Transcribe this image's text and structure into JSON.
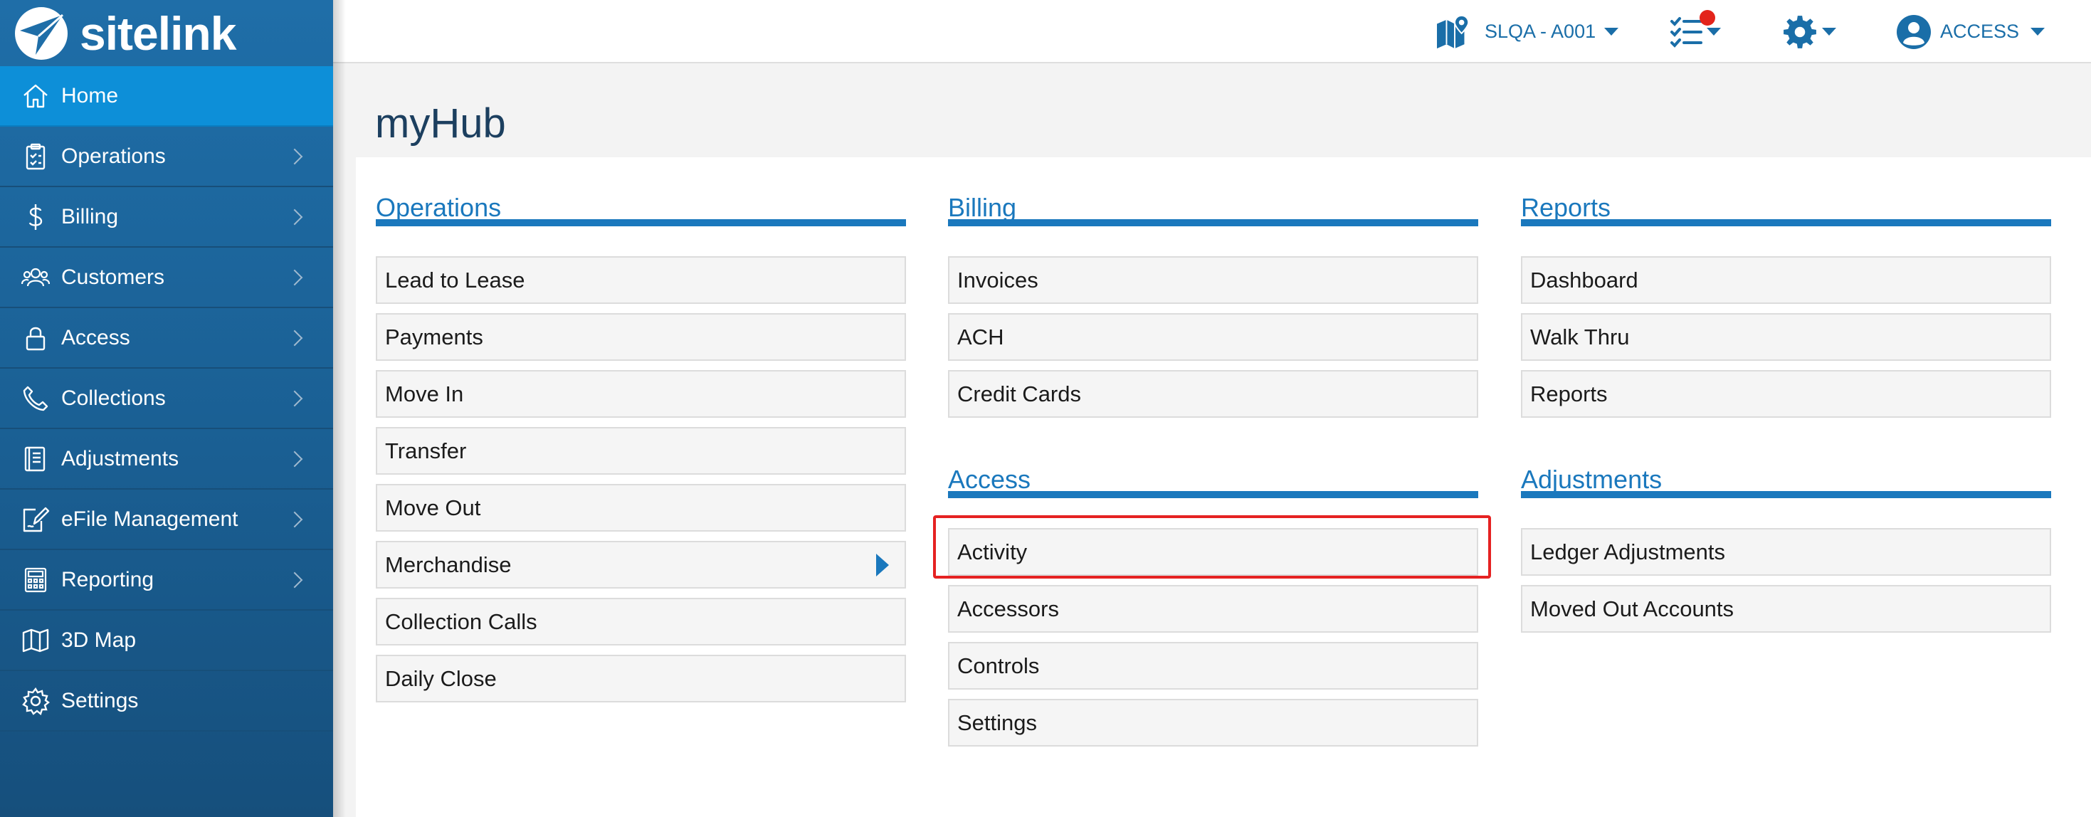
{
  "brand": {
    "name": "sitelink"
  },
  "sidebar": {
    "items": [
      {
        "label": "Home",
        "icon": "home-icon",
        "active": true,
        "expandable": false
      },
      {
        "label": "Operations",
        "icon": "clipboard-icon",
        "active": false,
        "expandable": true
      },
      {
        "label": "Billing",
        "icon": "dollar-icon",
        "active": false,
        "expandable": true
      },
      {
        "label": "Customers",
        "icon": "users-icon",
        "active": false,
        "expandable": true
      },
      {
        "label": "Access",
        "icon": "lock-icon",
        "active": false,
        "expandable": true
      },
      {
        "label": "Collections",
        "icon": "phone-icon",
        "active": false,
        "expandable": true
      },
      {
        "label": "Adjustments",
        "icon": "ledger-icon",
        "active": false,
        "expandable": true
      },
      {
        "label": "eFile Management",
        "icon": "file-edit-icon",
        "active": false,
        "expandable": true
      },
      {
        "label": "Reporting",
        "icon": "calculator-icon",
        "active": false,
        "expandable": true
      },
      {
        "label": "3D Map",
        "icon": "map-icon",
        "active": false,
        "expandable": false
      },
      {
        "label": "Settings",
        "icon": "gear-icon",
        "active": false,
        "expandable": false
      }
    ]
  },
  "header": {
    "location": {
      "label": "SLQA - A001",
      "icon": "map-pin-icon"
    },
    "tasks": {
      "icon": "task-list-icon",
      "has_notification": true
    },
    "settings": {
      "icon": "gear-icon"
    },
    "user": {
      "label": "ACCESS",
      "icon": "user-circle-icon"
    }
  },
  "page": {
    "title": "myHub"
  },
  "sections": {
    "operations": {
      "title": "Operations",
      "items": [
        "Lead to Lease",
        "Payments",
        "Move In",
        "Transfer",
        "Move Out",
        "Merchandise",
        "Collection Calls",
        "Daily Close"
      ]
    },
    "billing": {
      "title": "Billing",
      "items": [
        "Invoices",
        "ACH",
        "Credit Cards"
      ]
    },
    "access": {
      "title": "Access",
      "items": [
        "Activity",
        "Accessors",
        "Controls",
        "Settings"
      ]
    },
    "reports": {
      "title": "Reports",
      "items": [
        "Dashboard",
        "Walk Thru",
        "Reports"
      ]
    },
    "adjustments": {
      "title": "Adjustments",
      "items": [
        "Ledger Adjustments",
        "Moved Out Accounts"
      ]
    }
  },
  "colors": {
    "accent": "#1a78bd",
    "sidebar": "#1a5f93",
    "active": "#0d8fd8",
    "highlight": "#e52222",
    "notification": "#e3241b"
  }
}
